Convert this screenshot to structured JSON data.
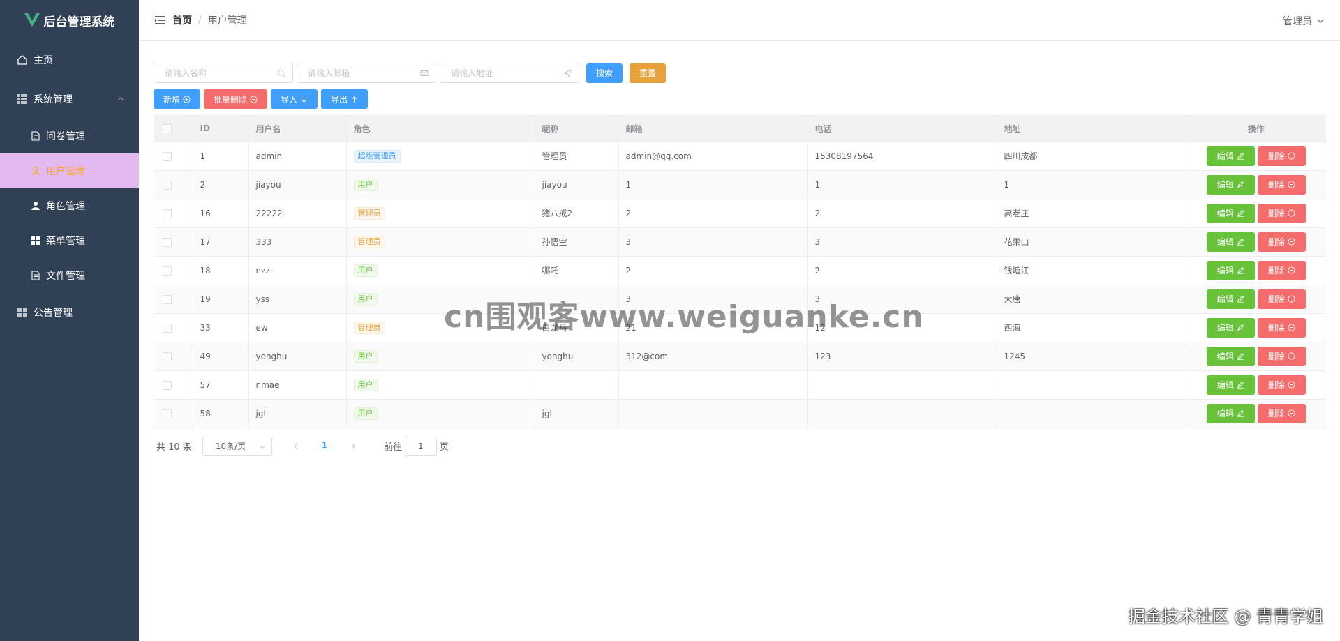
{
  "app": {
    "title": "后台管理系统",
    "brand_color": "#41b883"
  },
  "sidebar": {
    "items": [
      {
        "label": "主页",
        "icon": "house-icon"
      },
      {
        "label": "系统管理",
        "icon": "grid-icon",
        "expanded": true,
        "children": [
          {
            "label": "问卷管理",
            "icon": "document-icon"
          },
          {
            "label": "用户管理",
            "icon": "user-icon",
            "active": true
          },
          {
            "label": "角色管理",
            "icon": "person-icon"
          },
          {
            "label": "菜单管理",
            "icon": "menu-grid-icon"
          },
          {
            "label": "文件管理",
            "icon": "document-icon"
          }
        ]
      },
      {
        "label": "公告管理",
        "icon": "grid-icon"
      }
    ]
  },
  "header": {
    "breadcrumb": {
      "home": "首页",
      "separator": "/",
      "current": "用户管理"
    },
    "user": "管理员"
  },
  "search": {
    "name_placeholder": "请输入名称",
    "email_placeholder": "请输入邮箱",
    "address_placeholder": "请输入地址",
    "search_label": "搜索",
    "reset_label": "重置"
  },
  "actions": {
    "add_label": "新增",
    "batch_delete_label": "批量删除",
    "import_label": "导入",
    "export_label": "导出"
  },
  "table": {
    "columns": [
      "ID",
      "用户名",
      "角色",
      "昵称",
      "邮箱",
      "电话",
      "地址",
      "操作"
    ],
    "edit_label": "编辑",
    "delete_label": "删除",
    "rows": [
      {
        "id": "1",
        "username": "admin",
        "role": "超级管理员",
        "role_type": "primary",
        "nickname": "管理员",
        "email": "admin@qq.com",
        "phone": "15308197564",
        "address": "四川成都"
      },
      {
        "id": "2",
        "username": "jiayou",
        "role": "用户",
        "role_type": "success",
        "nickname": "jiayou",
        "email": "1",
        "phone": "1",
        "address": "1"
      },
      {
        "id": "16",
        "username": "22222",
        "role": "管理员",
        "role_type": "warning",
        "nickname": "猪八戒2",
        "email": "2",
        "phone": "2",
        "address": "高老庄"
      },
      {
        "id": "17",
        "username": "333",
        "role": "管理员",
        "role_type": "warning",
        "nickname": "孙悟空",
        "email": "3",
        "phone": "3",
        "address": "花果山"
      },
      {
        "id": "18",
        "username": "nzz",
        "role": "用户",
        "role_type": "success",
        "nickname": "哪吒",
        "email": "2",
        "phone": "2",
        "address": "钱塘江"
      },
      {
        "id": "19",
        "username": "yss",
        "role": "用户",
        "role_type": "success",
        "nickname": "",
        "email": "3",
        "phone": "3",
        "address": "大唐"
      },
      {
        "id": "33",
        "username": "ew",
        "role": "管理员",
        "role_type": "warning",
        "nickname": "白龙马",
        "email": "21",
        "phone": "12",
        "address": "西海"
      },
      {
        "id": "49",
        "username": "yonghu",
        "role": "用户",
        "role_type": "success",
        "nickname": "yonghu",
        "email": "312@com",
        "phone": "123",
        "address": "1245"
      },
      {
        "id": "57",
        "username": "nmae",
        "role": "用户",
        "role_type": "success",
        "nickname": "",
        "email": "",
        "phone": "",
        "address": ""
      },
      {
        "id": "58",
        "username": "jgt",
        "role": "用户",
        "role_type": "success",
        "nickname": "jgt",
        "email": "",
        "phone": "",
        "address": ""
      }
    ]
  },
  "pagination": {
    "total_text": "共 10 条",
    "page_size": "10条/页",
    "current_page": "1",
    "goto_prefix": "前往",
    "goto_value": "1",
    "goto_suffix": "页"
  },
  "watermark": {
    "text": "cn围观客www.weiguanke.cn",
    "corner": "掘金技术社区 @ 青青学姐"
  }
}
